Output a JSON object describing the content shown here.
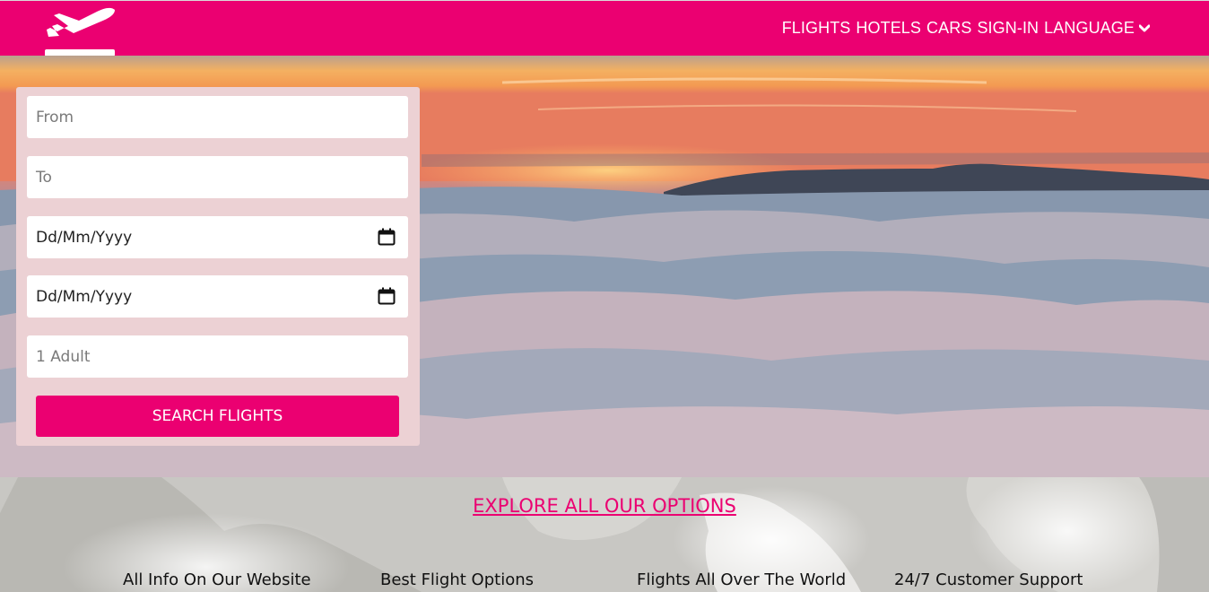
{
  "header": {
    "logo_icon": "airplane-takeoff-icon",
    "nav": [
      "FLIGHTS",
      "HOTELS",
      "CARS",
      "SIGN-IN",
      "LANGUAGE"
    ],
    "language_icon": "chevron-down-icon"
  },
  "search": {
    "from_placeholder": "From",
    "to_placeholder": "To",
    "depart_date": "Dd/Mm/Yyyy",
    "return_date": "Dd/Mm/Yyyy",
    "date_icon": "calendar-icon",
    "passengers_placeholder": "1 Adult",
    "button_label": "SEARCH FLIGHTS"
  },
  "explore": {
    "link": "EXPLORE ALL OUR OPTIONS",
    "features": [
      "All Info On Our Website",
      "Best Flight Options",
      "Flights All Over The World",
      "24/7 Customer Support"
    ]
  },
  "colors": {
    "brand": "#eb0071",
    "form_panel": "#ecd1d4"
  }
}
